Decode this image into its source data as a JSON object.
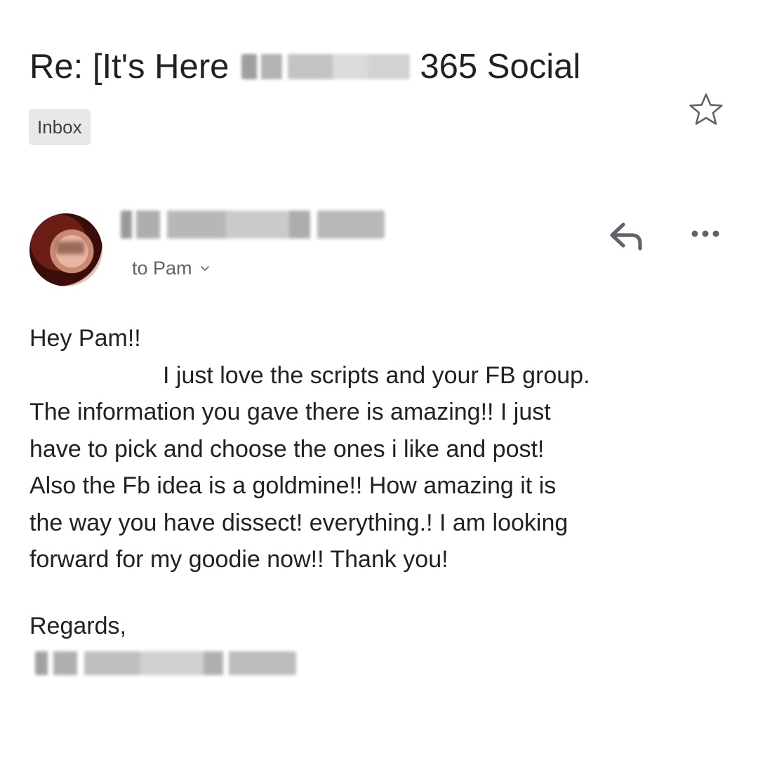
{
  "email": {
    "subject_start": "Re: [It's Here",
    "subject_end": "365 Social",
    "label": "Inbox",
    "recipient_line": "to Pam",
    "body": {
      "greeting": "Hey Pam!!",
      "lines": [
        "I just love the scripts and your FB group.",
        "The information you gave there is amazing!! I just",
        "have to pick and choose the ones i like and post!",
        "Also the Fb  idea is a goldmine!! How amazing it is",
        "the way you have dissect! everything.! I am looking",
        "forward for my goodie now!! Thank you!"
      ],
      "closing": "Regards,"
    }
  },
  "icons": {
    "star": "star-outline-icon",
    "reply": "reply-icon",
    "more": "more-horizontal-icon",
    "chevron": "chevron-down-icon"
  },
  "colors": {
    "text": "#202124",
    "secondary": "#5f6368",
    "chip_bg": "#e8e8e8",
    "icon": "#5f6368"
  }
}
